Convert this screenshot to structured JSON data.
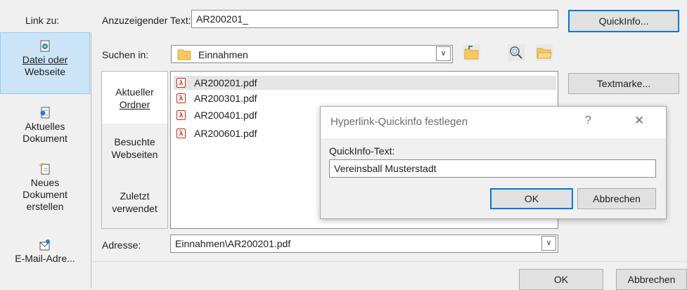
{
  "sidebar": {
    "header": "Link zu:",
    "items": [
      {
        "label1": "Datei oder",
        "label2": "Webseite",
        "icon": "file-globe-icon"
      },
      {
        "label1": "Aktuelles",
        "label2": "Dokument",
        "icon": "document-link-icon"
      },
      {
        "label1": "Neues",
        "label2": "Dokument",
        "label3": "erstellen",
        "icon": "new-document-icon"
      },
      {
        "label1": "E-Mail-Adre...",
        "icon": "email-icon"
      }
    ]
  },
  "display_text": {
    "label": "Anzuzeigender Text:",
    "value": "AR200201_"
  },
  "quickinfo_button": "QuickInfo...",
  "search_in": {
    "label": "Suchen in:",
    "value": "Einnahmen"
  },
  "locations": [
    {
      "line1": "Aktueller",
      "line2": "Ordner"
    },
    {
      "line1": "Besuchte",
      "line2": "Webseiten"
    },
    {
      "line1": "Zuletzt",
      "line2": "verwendet"
    }
  ],
  "files": [
    "AR200201.pdf",
    "AR200301.pdf",
    "AR200401.pdf",
    "AR200601.pdf"
  ],
  "bookmark_button": "Textmarke...",
  "address": {
    "label": "Adresse:",
    "value": "Einnahmen\\AR200201.pdf"
  },
  "ok_button": "OK",
  "cancel_button": "Abbrechen",
  "dialog": {
    "title": "Hyperlink-Quickinfo festlegen",
    "help": "?",
    "close": "✕",
    "field_label": "QuickInfo-Text:",
    "field_value": "Vereinsball Musterstadt",
    "ok": "OK",
    "cancel": "Abbrechen"
  },
  "colors": {
    "accent": "#0078d7",
    "selected_nav": "#cce4f7",
    "pdf_red": "#d0271d"
  }
}
